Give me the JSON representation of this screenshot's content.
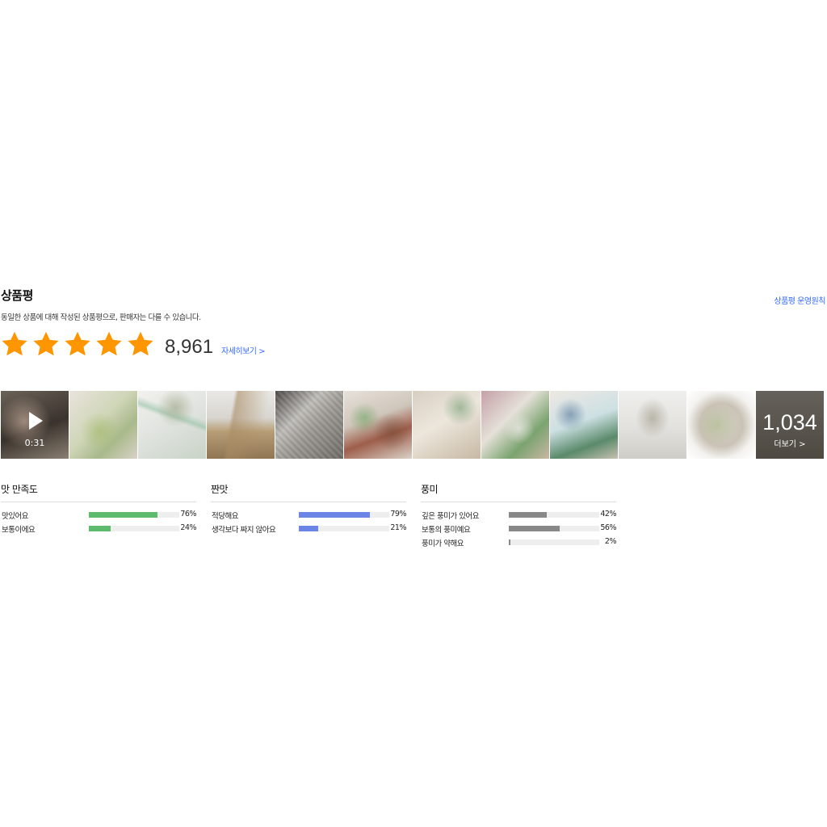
{
  "review": {
    "title": "상품평",
    "policy_link": "상품평 운영원칙",
    "description": "동일한 상품에 대해 작성된 상품평으로, 판매자는 다를 수 있습니다.",
    "rating": {
      "stars": 5,
      "max_stars": 5,
      "star_color": "#ff9600"
    },
    "count": "8,961",
    "detail_link": "자세히보기 >",
    "photos": [
      {
        "type": "video",
        "duration": "0:31"
      },
      {
        "type": "image"
      },
      {
        "type": "image"
      },
      {
        "type": "image"
      },
      {
        "type": "image"
      },
      {
        "type": "image"
      },
      {
        "type": "image"
      },
      {
        "type": "image"
      },
      {
        "type": "image"
      },
      {
        "type": "image"
      },
      {
        "type": "image"
      },
      {
        "type": "more",
        "count": "1,034",
        "label": "더보기 >"
      }
    ],
    "surveys": [
      {
        "title": "맛 만족도",
        "color": "#5dbb6e",
        "rows": [
          {
            "label": "맛있어요",
            "percent": 76,
            "percent_label": "76%"
          },
          {
            "label": "보통이에요",
            "percent": 24,
            "percent_label": "24%"
          }
        ]
      },
      {
        "title": "짠맛",
        "color": "#6a85e6",
        "rows": [
          {
            "label": "적당해요",
            "percent": 79,
            "percent_label": "79%"
          },
          {
            "label": "생각보다 짜지 않아요",
            "percent": 21,
            "percent_label": "21%"
          }
        ]
      },
      {
        "title": "풍미",
        "color": "#888888",
        "rows": [
          {
            "label": "깊은 풍미가 있어요",
            "percent": 42,
            "percent_label": "42%"
          },
          {
            "label": "보통의 풍미예요",
            "percent": 56,
            "percent_label": "56%"
          },
          {
            "label": "풍미가 약해요",
            "percent": 2,
            "percent_label": "2%"
          }
        ]
      }
    ]
  }
}
